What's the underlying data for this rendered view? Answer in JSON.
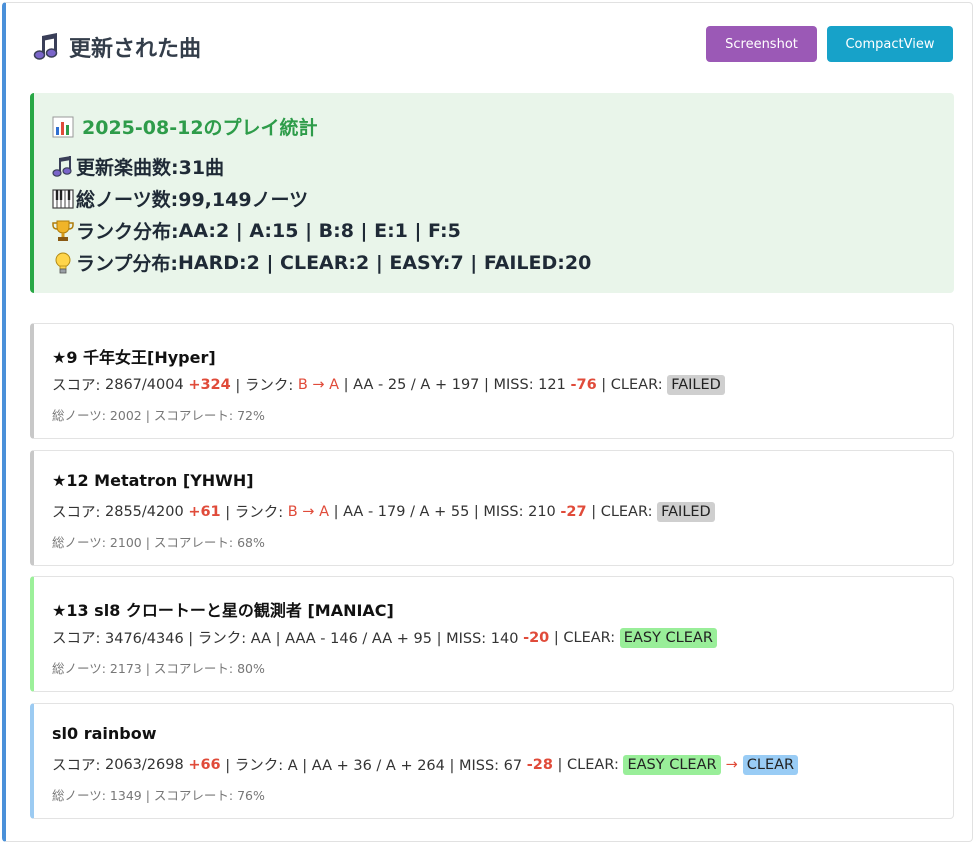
{
  "header": {
    "title": "更新された曲",
    "title_icon": "music-note-icon",
    "buttons": {
      "screenshot": "Screenshot",
      "compact": "CompactView"
    },
    "colors": {
      "screenshot": "#9b59b6",
      "compact": "#17a2c9"
    }
  },
  "stats": {
    "title": "2025-08-12のプレイ統計",
    "lines": [
      {
        "icon": "music-note-icon",
        "label": "更新楽曲数: ",
        "value": "31曲"
      },
      {
        "icon": "piano-keys-icon",
        "label": "総ノーツ数: ",
        "value": "99,149ノーツ"
      },
      {
        "icon": "trophy-icon",
        "label": "ランク分布: ",
        "value": "AA:2 | A:15 | B:8 | E:1 | F:5"
      },
      {
        "icon": "lightbulb-icon",
        "label": "ランプ分布: ",
        "value": "HARD:2 | CLEAR:2 | EASY:7 | FAILED:20"
      }
    ],
    "accent_color": "#28a745"
  },
  "songs": [
    {
      "title": "★9 千年女王[Hyper]",
      "score_label": "スコア: ",
      "score": "2867/4004",
      "score_diff": "+324",
      "rank_label": " | ランク: ",
      "rank": "B → A",
      "rank_detail": " | AA - 25 / A + 197 | MISS: 121 ",
      "miss_diff": "-76",
      "clear_label": " | CLEAR: ",
      "lamp": "FAILED",
      "notes": "総ノーツ: 2002 | スコアレート: 72%"
    },
    {
      "title": "★12 Metatron [YHWH]",
      "score_label": "スコア: ",
      "score": "2855/4200",
      "score_diff": "+61",
      "rank_label": " | ランク: ",
      "rank": "B → A",
      "rank_detail": " | AA - 179 / A + 55 | MISS: 210 ",
      "miss_diff": "-27",
      "clear_label": " | CLEAR: ",
      "lamp": "FAILED",
      "notes": "総ノーツ: 2100 | スコアレート: 68%"
    },
    {
      "title": "★13 sl8 クロートーと星の観測者 [MANIAC]",
      "score_text": "スコア: 3476/4346 | ランク: AA | AAA - 146 / AA + 95 | MISS: 140 ",
      "miss_diff": "-20",
      "clear_label": " | CLEAR: ",
      "lamp": "EASY CLEAR",
      "notes": "総ノーツ: 2173 | スコアレート: 80%"
    },
    {
      "title": "sl0 rainbow",
      "score_label": "スコア: ",
      "score": "2063/2698",
      "score_diff": "+66",
      "rank_text": " | ランク: A | AA + 36 / A + 264 | MISS: 67 ",
      "miss_diff": "-28",
      "clear_label": " | CLEAR: ",
      "lamp_from": "EASY CLEAR",
      "lamp_arrow": "→",
      "lamp_to": "CLEAR",
      "notes": "総ノーツ: 1349 | スコアレート: 76%"
    }
  ]
}
